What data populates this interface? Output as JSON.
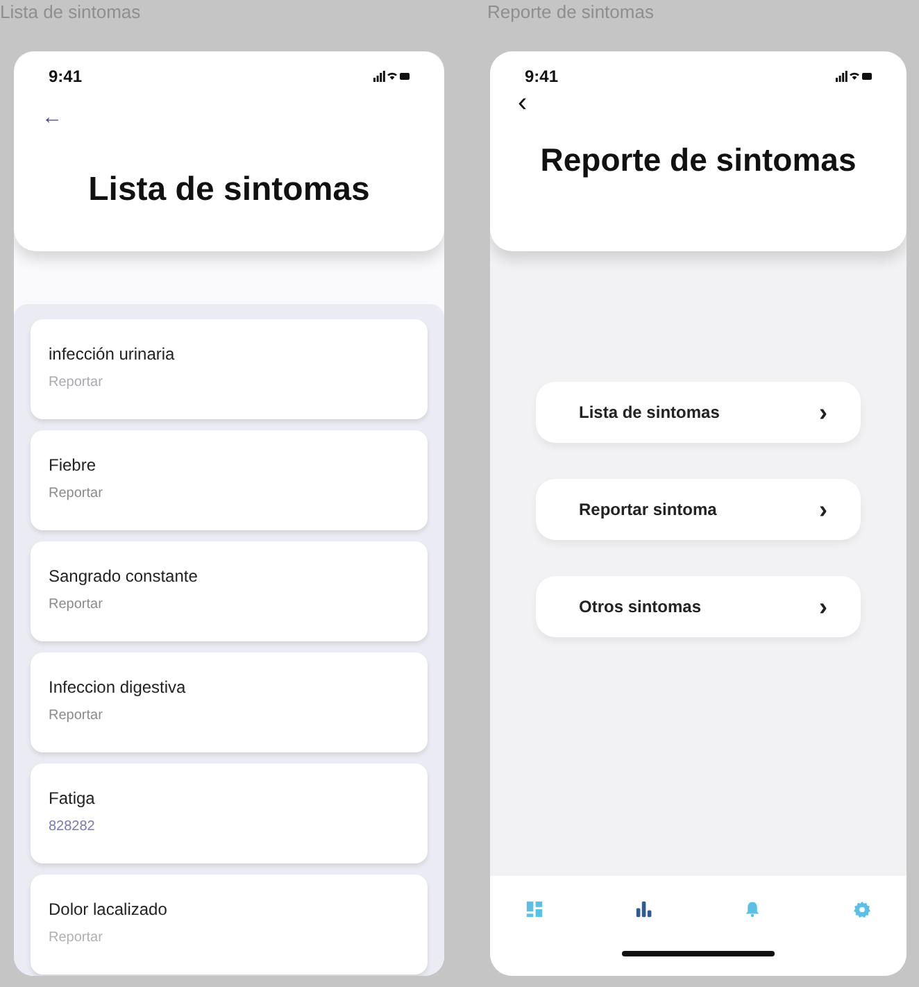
{
  "screens": [
    {
      "label": "Lista de sintomas",
      "time": "9:41",
      "back": "←",
      "title": "Lista de sintomas",
      "kind": "list",
      "items": [
        {
          "title": "infección urinaria",
          "subtitle": "Reportar",
          "color": "#a9a9b0"
        },
        {
          "title": "Fiebre",
          "subtitle": "Reportar",
          "color": "#8a8a8a"
        },
        {
          "title": "Sangrado constante",
          "subtitle": "Reportar",
          "color": "#8a8a8a"
        },
        {
          "title": "Infeccion digestiva",
          "subtitle": "Reportar",
          "color": "#8a8a8a"
        },
        {
          "title": "Fatiga",
          "subtitle": "828282",
          "color": "#7b79b3"
        },
        {
          "title": "Dolor lacalizado",
          "subtitle": "Reportar",
          "color": "#b0b0b0"
        }
      ]
    },
    {
      "label": "Reporte de sintomas",
      "time": "9:41",
      "back": "‹",
      "title": "Reporte de sintomas",
      "kind": "menu",
      "items": [
        {
          "title": "Lista de sintomas",
          "chevron": "›"
        },
        {
          "title": "Reportar sintoma",
          "chevron": "›"
        },
        {
          "title": "Otros sintomas",
          "chevron": "›"
        }
      ],
      "nav": [
        {
          "kind": "grid",
          "selected": false
        },
        {
          "kind": "chart",
          "selected": true
        },
        {
          "kind": "bell",
          "selected": false
        },
        {
          "kind": "gear",
          "selected": false
        }
      ]
    }
  ]
}
